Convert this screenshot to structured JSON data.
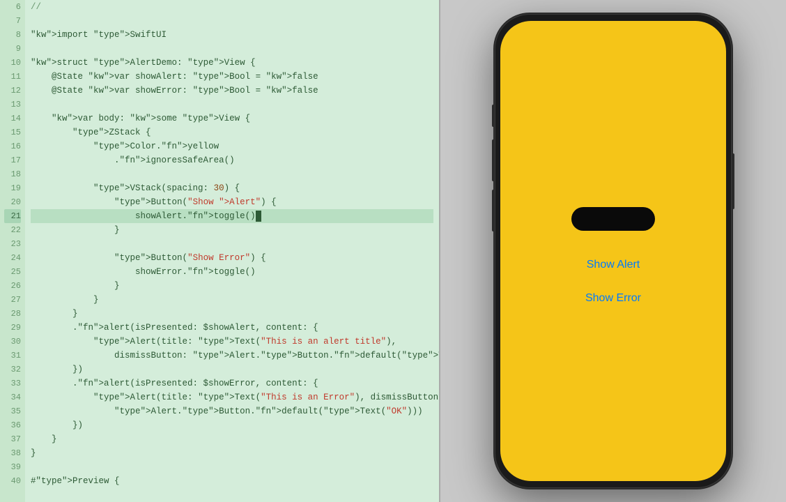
{
  "editor": {
    "background_color": "#d4edda",
    "lines": [
      {
        "num": "6",
        "text": "//",
        "highlight": false
      },
      {
        "num": "7",
        "text": "",
        "highlight": false
      },
      {
        "num": "8",
        "text": "import SwiftUI",
        "highlight": false
      },
      {
        "num": "9",
        "text": "",
        "highlight": false
      },
      {
        "num": "10",
        "text": "struct AlertDemo: View {",
        "highlight": false
      },
      {
        "num": "11",
        "text": "    @State var showAlert: Bool = false",
        "highlight": false
      },
      {
        "num": "12",
        "text": "    @State var showError: Bool = false",
        "highlight": false
      },
      {
        "num": "13",
        "text": "",
        "highlight": false
      },
      {
        "num": "14",
        "text": "    var body: some View {",
        "highlight": false
      },
      {
        "num": "15",
        "text": "        ZStack {",
        "highlight": false
      },
      {
        "num": "16",
        "text": "            Color.yellow",
        "highlight": false
      },
      {
        "num": "17",
        "text": "                .ignoresSafeArea()",
        "highlight": false
      },
      {
        "num": "18",
        "text": "",
        "highlight": false
      },
      {
        "num": "19",
        "text": "            VStack(spacing: 30) {",
        "highlight": false
      },
      {
        "num": "20",
        "text": "                Button(\"Show Alert\") {",
        "highlight": false
      },
      {
        "num": "21",
        "text": "                    showAlert.toggle()",
        "highlight": true
      },
      {
        "num": "22",
        "text": "                }",
        "highlight": false
      },
      {
        "num": "23",
        "text": "",
        "highlight": false
      },
      {
        "num": "24",
        "text": "                Button(\"Show Error\") {",
        "highlight": false
      },
      {
        "num": "25",
        "text": "                    showError.toggle()",
        "highlight": false
      },
      {
        "num": "26",
        "text": "                }",
        "highlight": false
      },
      {
        "num": "27",
        "text": "            }",
        "highlight": false
      },
      {
        "num": "28",
        "text": "        }",
        "highlight": false
      },
      {
        "num": "29",
        "text": "        .alert(isPresented: $showAlert, content: {",
        "highlight": false
      },
      {
        "num": "30",
        "text": "            Alert(title: Text(\"This is an alert title\"),",
        "highlight": false
      },
      {
        "num": "31",
        "text": "                dismissButton: Alert.Button.default(Text(\"OK\")))",
        "highlight": false
      },
      {
        "num": "32",
        "text": "        })",
        "highlight": false
      },
      {
        "num": "33",
        "text": "        .alert(isPresented: $showError, content: {",
        "highlight": false
      },
      {
        "num": "34",
        "text": "            Alert(title: Text(\"This is an Error\"), dismissButton:",
        "highlight": false
      },
      {
        "num": "35",
        "text": "                Alert.Button.default(Text(\"OK\")))",
        "highlight": false
      },
      {
        "num": "36",
        "text": "        })",
        "highlight": false
      },
      {
        "num": "37",
        "text": "    }",
        "highlight": false
      },
      {
        "num": "38",
        "text": "}",
        "highlight": false
      },
      {
        "num": "39",
        "text": "",
        "highlight": false
      },
      {
        "num": "40",
        "text": "#Preview {",
        "highlight": false
      }
    ]
  },
  "phone": {
    "screen_color": "#f5c518",
    "buttons": [
      {
        "label": "Show Alert"
      },
      {
        "label": "Show Error"
      }
    ],
    "button_color": "#007aff"
  }
}
